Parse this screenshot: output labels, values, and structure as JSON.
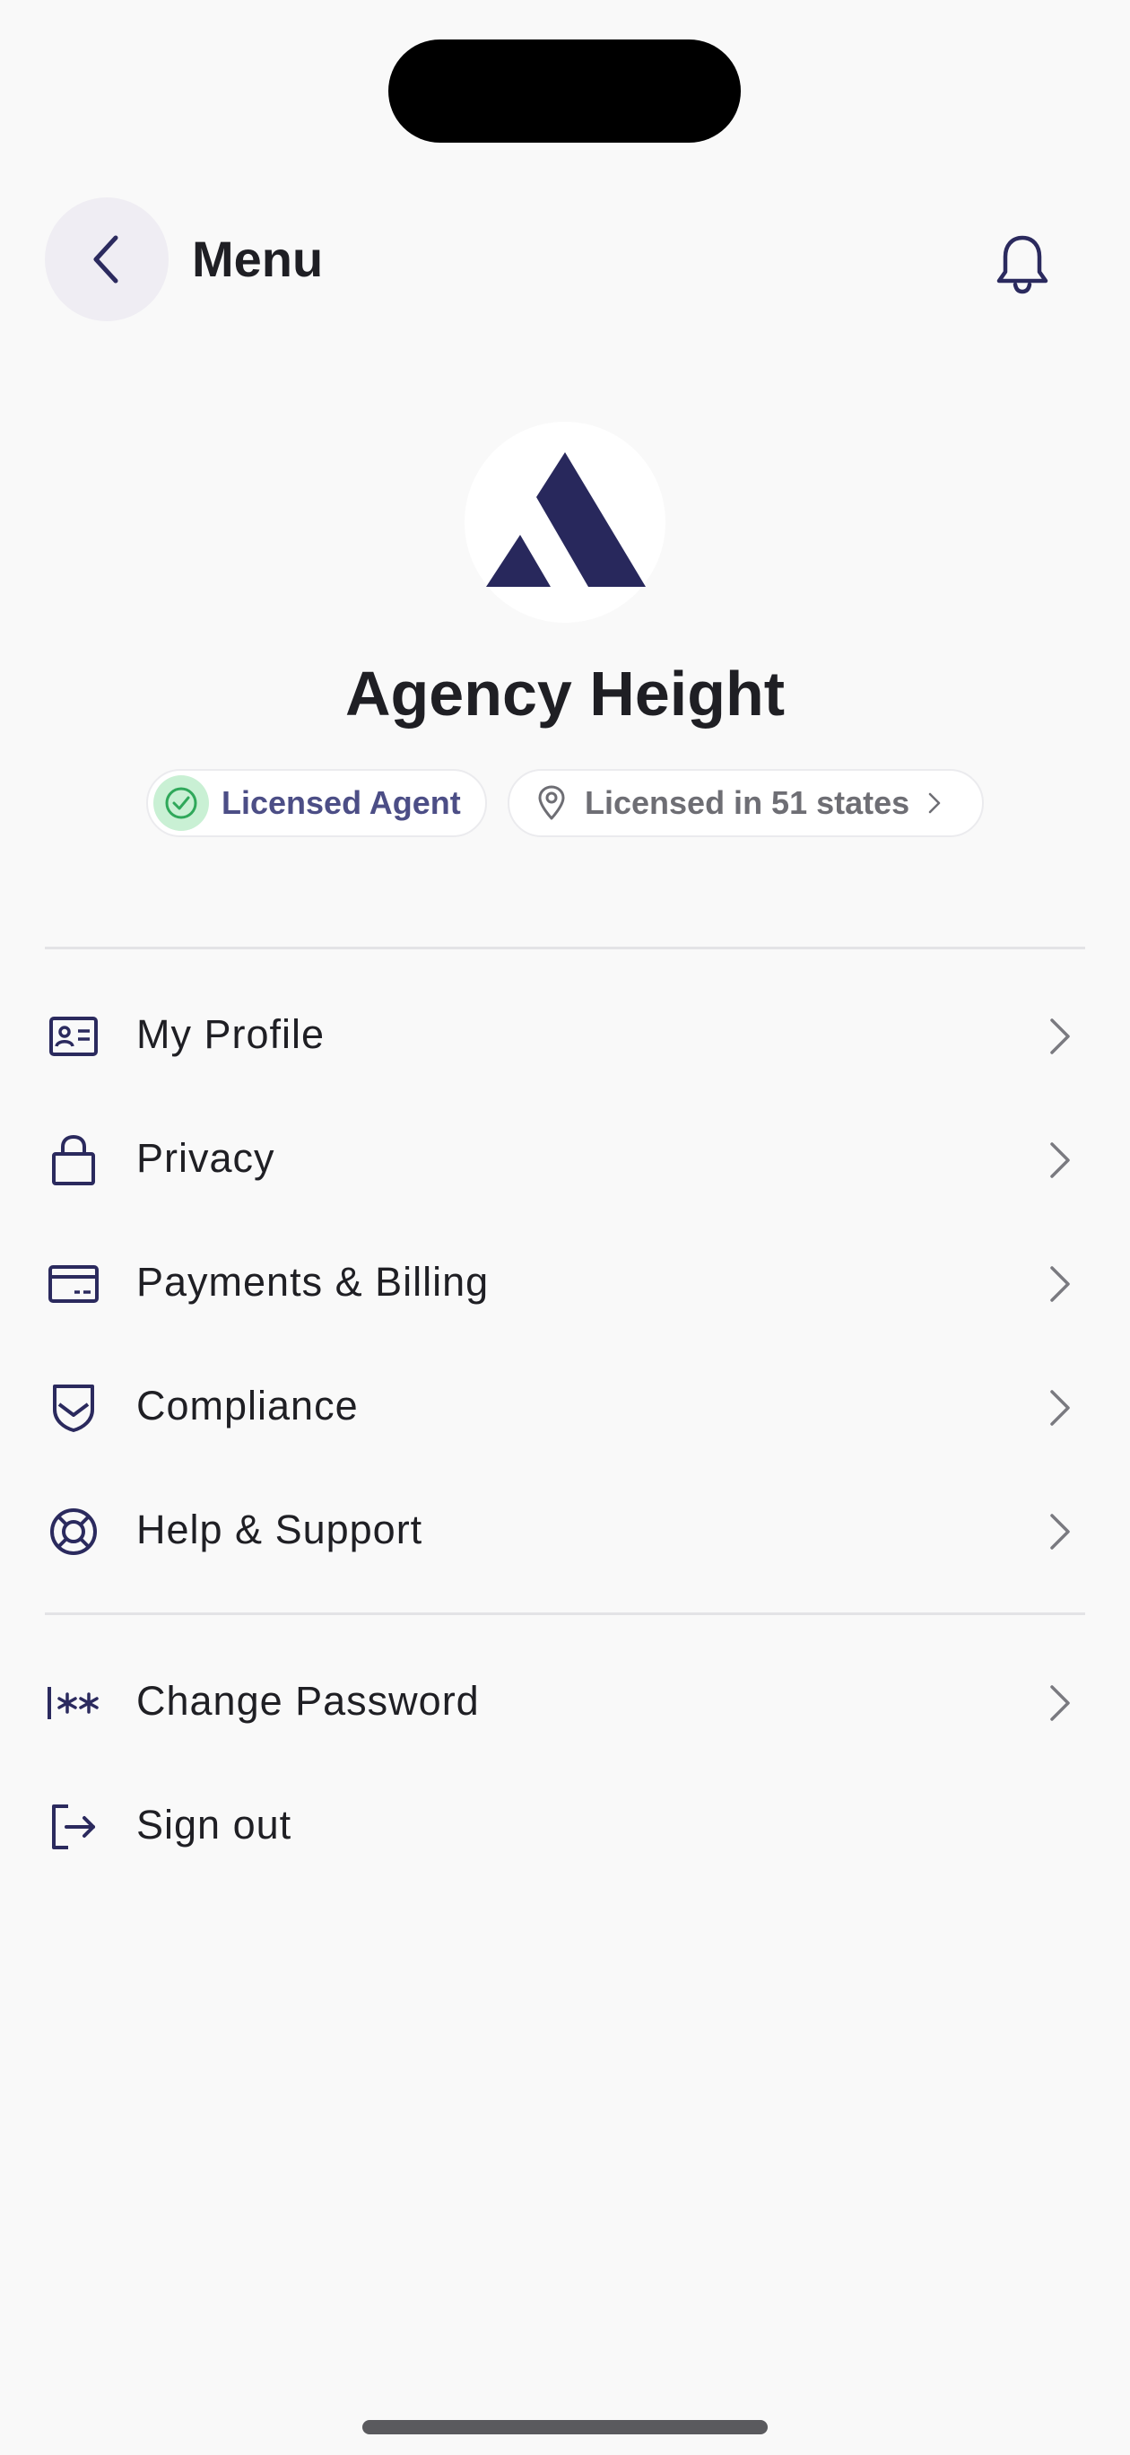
{
  "header": {
    "title": "Menu"
  },
  "profile": {
    "name": "Agency Height",
    "badges": {
      "licensed_label": "Licensed Agent",
      "states_label": "Licensed in 51 states"
    }
  },
  "menu": {
    "primary": [
      {
        "label": "My Profile",
        "icon": "id-card-icon"
      },
      {
        "label": "Privacy",
        "icon": "lock-icon"
      },
      {
        "label": "Payments & Billing",
        "icon": "credit-card-icon"
      },
      {
        "label": "Compliance",
        "icon": "shield-icon"
      },
      {
        "label": "Help & Support",
        "icon": "lifebuoy-icon"
      }
    ],
    "secondary": [
      {
        "label": "Change Password",
        "icon": "password-icon"
      },
      {
        "label": "Sign out",
        "icon": "sign-out-icon"
      }
    ]
  },
  "colors": {
    "accent": "#2b2a5e",
    "licensed_badge_bg": "#c9f0d4",
    "licensed_text": "#4c4e86",
    "background": "#f9f9f9"
  }
}
